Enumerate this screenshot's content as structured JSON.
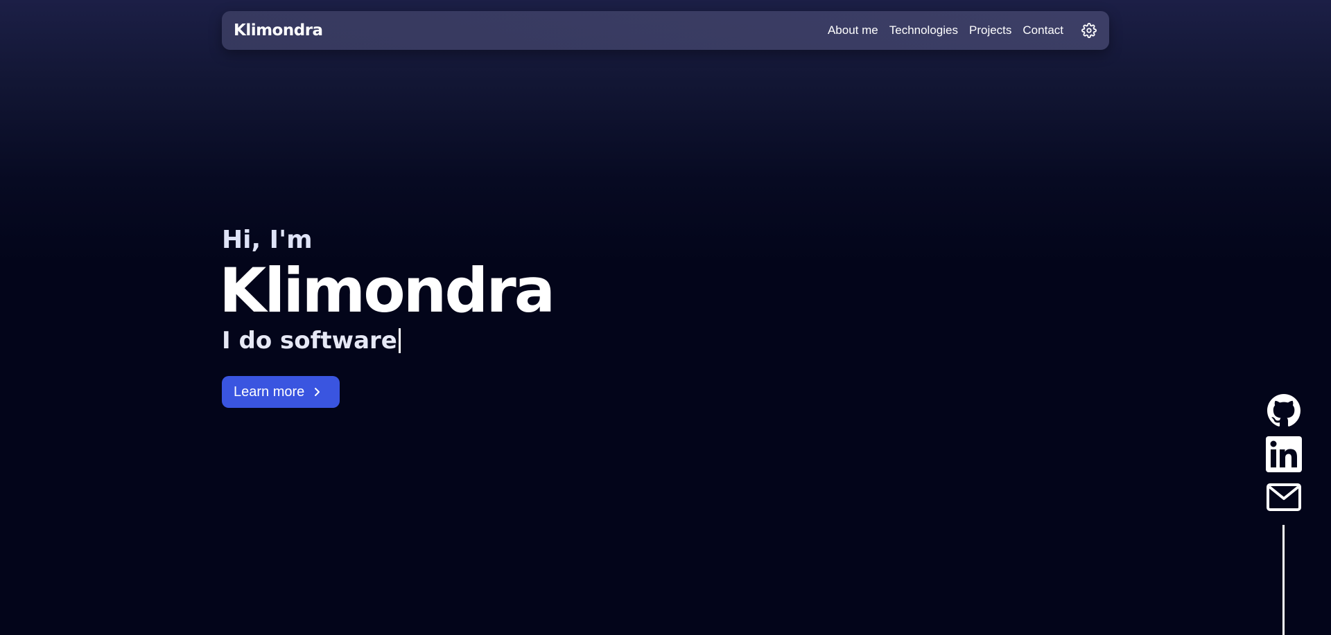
{
  "header": {
    "brand": "Klimondra",
    "nav": [
      {
        "label": "About me"
      },
      {
        "label": "Technologies"
      },
      {
        "label": "Projects"
      },
      {
        "label": "Contact"
      }
    ],
    "settings_icon": "gear-icon"
  },
  "hero": {
    "greeting": "Hi, I'm",
    "name": "Klimondra",
    "tagline": "I do software",
    "cta_label": "Learn more",
    "cta_icon": "chevron-right-icon"
  },
  "socials": [
    {
      "icon": "github-icon"
    },
    {
      "icon": "linkedin-icon"
    },
    {
      "icon": "mail-icon"
    }
  ],
  "colors": {
    "accent": "#3a55e0",
    "background": "#03051a",
    "navbar": "#3c3e64"
  }
}
